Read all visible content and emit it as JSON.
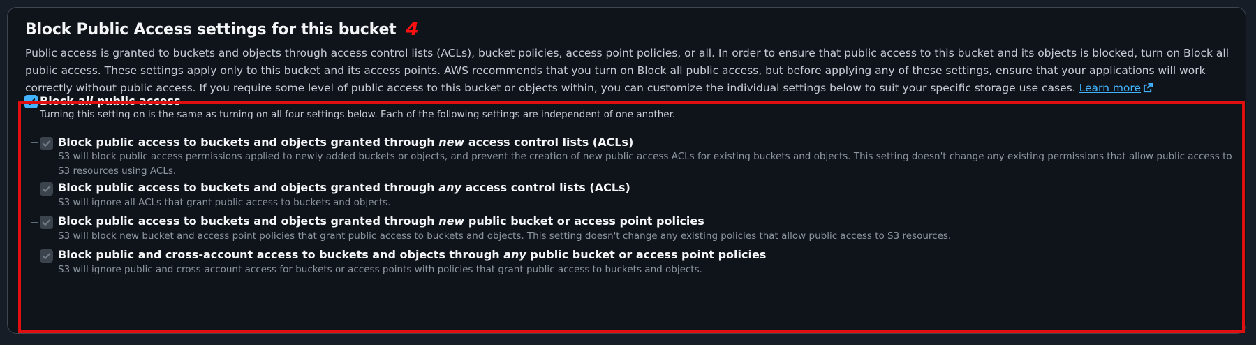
{
  "section": {
    "title": "Block Public Access settings for this bucket",
    "annotation_number": "4",
    "description": "Public access is granted to buckets and objects through access control lists (ACLs), bucket policies, access point policies, or all. In order to ensure that public access to this bucket and its objects is blocked, turn on Block all public access. These settings apply only to this bucket and its access points. AWS recommends that you turn on Block all public access, but before applying any of these settings, ensure that your applications will work correctly without public access. If you require some level of public access to this bucket or objects within, you can customize the individual settings below to suit your specific storage use cases.",
    "learn_more": "Learn more"
  },
  "block_all": {
    "label_pre": "Block ",
    "label_em": "all",
    "label_post": " public access",
    "description": "Turning this setting on is the same as turning on all four settings below. Each of the following settings are independent of one another.",
    "checked": true
  },
  "options": [
    {
      "label_pre": "Block public access to buckets and objects granted through ",
      "label_em": "new",
      "label_post": " access control lists (ACLs)",
      "description": "S3 will block public access permissions applied to newly added buckets or objects, and prevent the creation of new public access ACLs for existing buckets and objects. This setting doesn't change any existing permissions that allow public access to S3 resources using ACLs.",
      "checked": true
    },
    {
      "label_pre": "Block public access to buckets and objects granted through ",
      "label_em": "any",
      "label_post": " access control lists (ACLs)",
      "description": "S3 will ignore all ACLs that grant public access to buckets and objects.",
      "checked": true
    },
    {
      "label_pre": "Block public access to buckets and objects granted through ",
      "label_em": "new",
      "label_post": " public bucket or access point policies",
      "description": "S3 will block new bucket and access point policies that grant public access to buckets and objects. This setting doesn't change any existing policies that allow public access to S3 resources.",
      "checked": true
    },
    {
      "label_pre": "Block public and cross-account access to buckets and objects through ",
      "label_em": "any",
      "label_post": " public bucket or access point policies",
      "description": "S3 will ignore public and cross-account access for buckets or access points with policies that grant public access to buckets and objects.",
      "checked": true
    }
  ],
  "colors": {
    "accent": "#42b4ff",
    "highlight_box": "#e01010",
    "annotation": "#ff1010"
  },
  "icons": {
    "checkbox": "check-icon",
    "external_link": "external-link-icon"
  }
}
